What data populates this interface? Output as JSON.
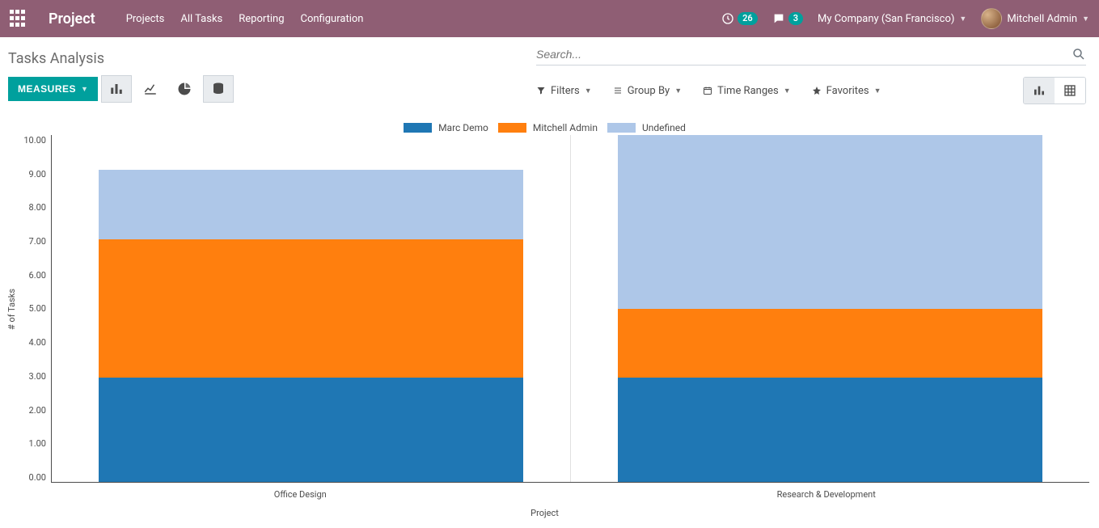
{
  "navbar": {
    "brand": "Project",
    "menu": [
      "Projects",
      "All Tasks",
      "Reporting",
      "Configuration"
    ],
    "activity_count": "26",
    "chat_count": "3",
    "company": "My Company (San Francisco)",
    "user": "Mitchell Admin"
  },
  "page": {
    "title": "Tasks Analysis",
    "measures_label": "MEASURES"
  },
  "search": {
    "placeholder": "Search..."
  },
  "filters": {
    "filters": "Filters",
    "group_by": "Group By",
    "time_ranges": "Time Ranges",
    "favorites": "Favorites"
  },
  "chart_data": {
    "type": "bar",
    "stacked": true,
    "xlabel": "Project",
    "ylabel": "# of Tasks",
    "ylim": [
      0,
      10
    ],
    "yticks": [
      "10.00",
      "9.00",
      "8.00",
      "7.00",
      "6.00",
      "5.00",
      "4.00",
      "3.00",
      "2.00",
      "1.00",
      "0.00"
    ],
    "categories": [
      "Office Design",
      "Research & Development"
    ],
    "series": [
      {
        "name": "Marc Demo",
        "color": "#1f77b4",
        "values": [
          3,
          3
        ]
      },
      {
        "name": "Mitchell Admin",
        "color": "#ff7f0e",
        "values": [
          4,
          2
        ]
      },
      {
        "name": "Undefined",
        "color": "#aec7e8",
        "values": [
          2,
          5
        ]
      }
    ]
  }
}
